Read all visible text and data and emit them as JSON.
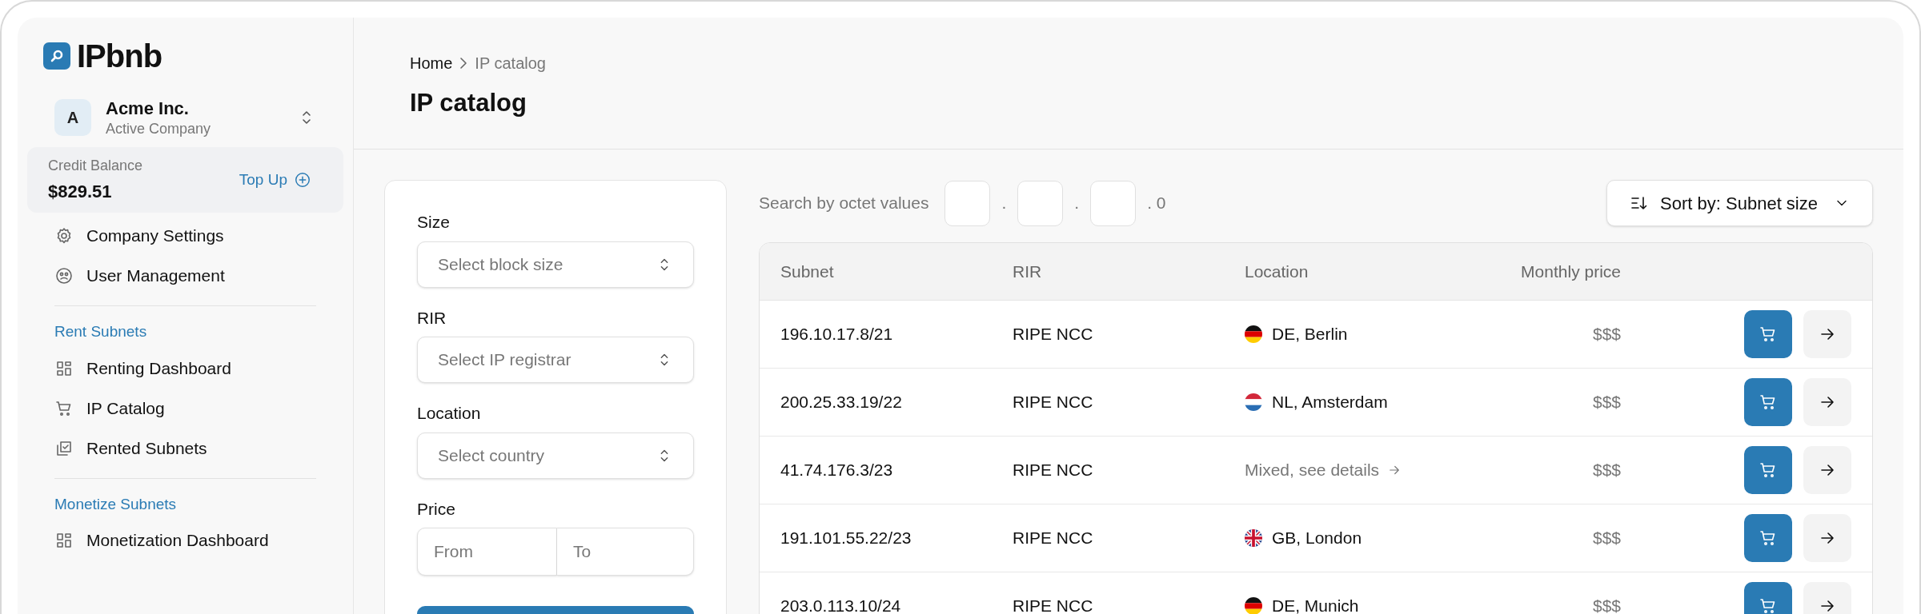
{
  "sidebar": {
    "logo": "IPbnb",
    "company": {
      "initial": "A",
      "name": "Acme Inc.",
      "subtitle": "Active Company"
    },
    "credit": {
      "label": "Credit Balance",
      "amount": "$829.51",
      "action": "Top Up"
    },
    "sections": [
      {
        "items": [
          {
            "label": "Company Settings"
          },
          {
            "label": "User Management"
          }
        ]
      },
      {
        "heading": "Rent Subnets",
        "items": [
          {
            "label": "Renting Dashboard"
          },
          {
            "label": "IP Catalog"
          },
          {
            "label": "Rented Subnets"
          }
        ]
      },
      {
        "heading": "Monetize Subnets",
        "items": [
          {
            "label": "Monetization Dashboard"
          }
        ]
      }
    ]
  },
  "breadcrumb": [
    "Home",
    "IP catalog"
  ],
  "title": "IP catalog",
  "filters": {
    "fields": [
      {
        "label": "Size",
        "placeholder": "Select block size"
      },
      {
        "label": "RIR",
        "placeholder": "Select IP registrar"
      },
      {
        "label": "Location",
        "placeholder": "Select country"
      }
    ],
    "price": {
      "label": "Price",
      "from_placeholder": "From",
      "to_placeholder": "To"
    }
  },
  "search": {
    "label": "Search by octet values",
    "suffix": ". 0",
    "separator": "."
  },
  "sort": {
    "label": "Sort by: Subnet size"
  },
  "table": {
    "columns": [
      "Subnet",
      "RIR",
      "Location",
      "Monthly price"
    ],
    "rows": [
      {
        "subnet": "196.10.17.8/21",
        "rir": "RIPE NCC",
        "location": {
          "kind": "de",
          "text": "DE, Berlin"
        },
        "price": "$$$"
      },
      {
        "subnet": "200.25.33.19/22",
        "rir": "RIPE NCC",
        "location": {
          "kind": "nl",
          "text": "NL, Amsterdam"
        },
        "price": "$$$"
      },
      {
        "subnet": "41.74.176.3/23",
        "rir": "RIPE NCC",
        "location": {
          "kind": "mixed",
          "text": "Mixed, see details"
        },
        "price": "$$$"
      },
      {
        "subnet": "191.101.55.22/23",
        "rir": "RIPE NCC",
        "location": {
          "kind": "gb",
          "text": "GB, London"
        },
        "price": "$$$"
      },
      {
        "subnet": "203.0.113.10/24",
        "rir": "RIPE NCC",
        "location": {
          "kind": "de",
          "text": "DE, Munich"
        },
        "price": "$$$"
      }
    ]
  }
}
